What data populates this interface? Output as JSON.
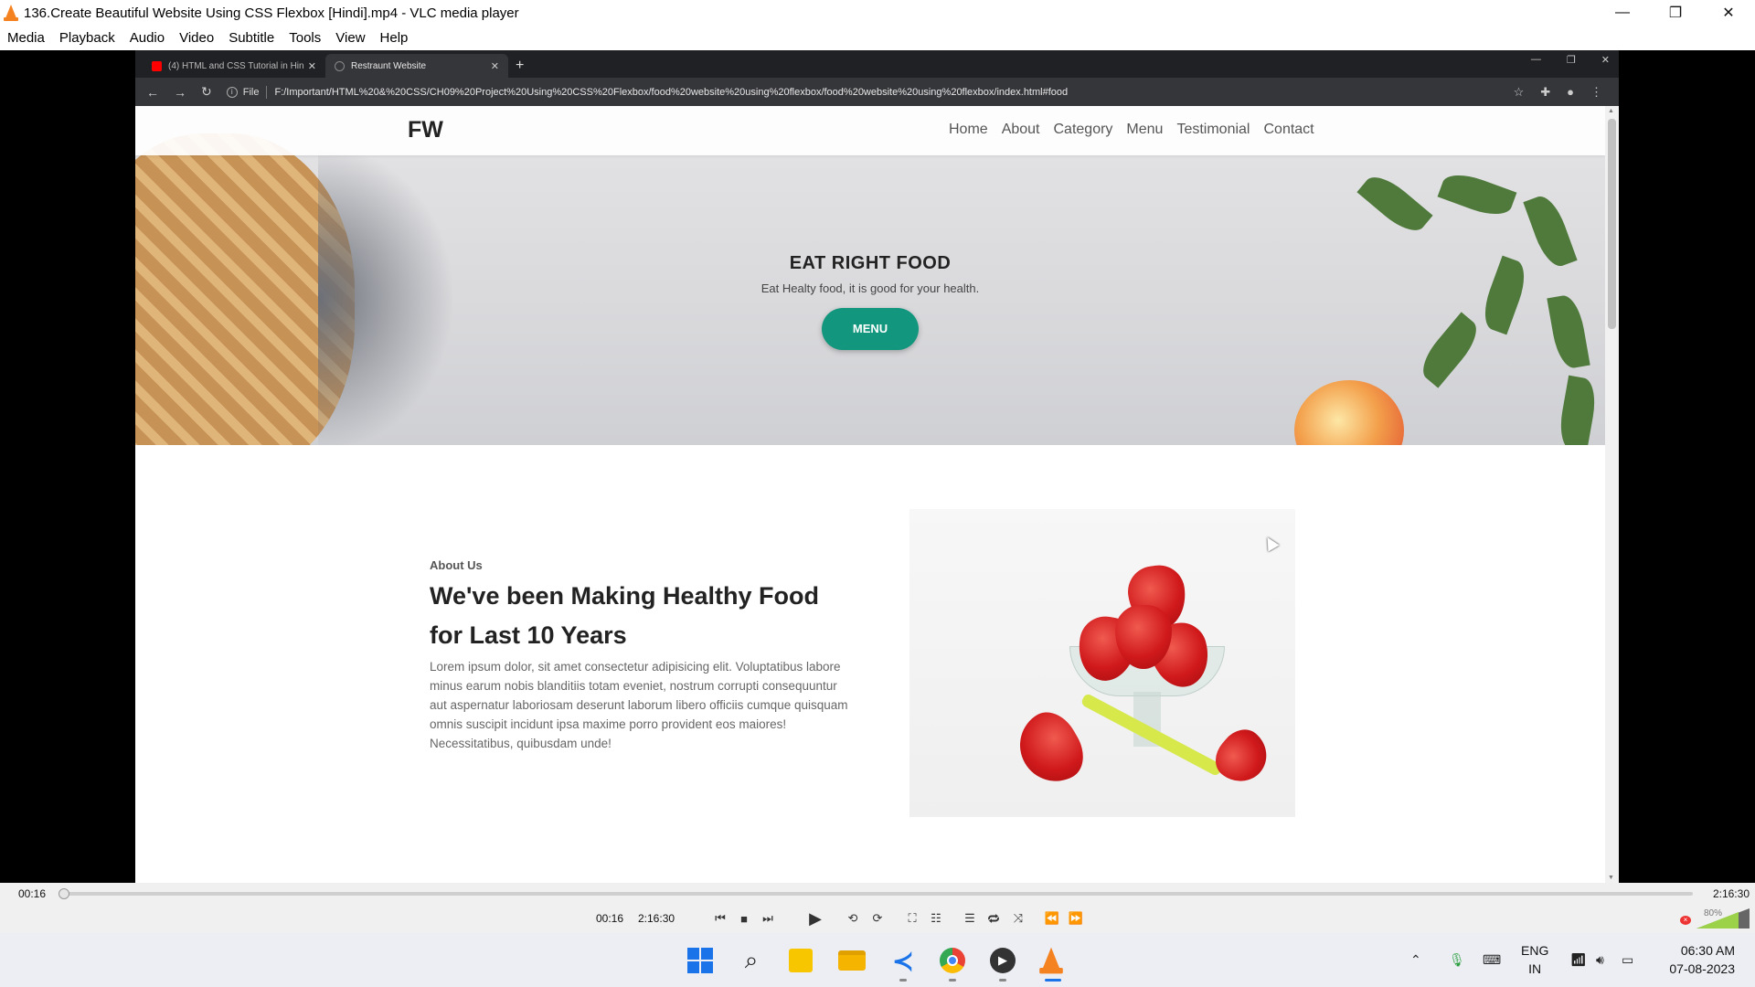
{
  "window": {
    "title": "136.Create Beautiful Website Using CSS Flexbox [Hindi].mp4 - VLC media player",
    "controls": [
      "—",
      "❐",
      "✕"
    ]
  },
  "menu": [
    "Media",
    "Playback",
    "Audio",
    "Video",
    "Subtitle",
    "Tools",
    "View",
    "Help"
  ],
  "browser": {
    "tabs": [
      {
        "label": "(4) HTML and CSS Tutorial in Hin",
        "icon": "youtube-icon"
      },
      {
        "label": "Restraunt Website",
        "icon": "globe-icon"
      }
    ],
    "new_tab": "+",
    "file_label": "File",
    "url": "F:/Important/HTML%20&%20CSS/CH09%20Project%20Using%20CSS%20Flexbox/food%20website%20using%20flexbox/food%20website%20using%20flexbox/index.html#food"
  },
  "site": {
    "logo": "FW",
    "nav": [
      "Home",
      "About",
      "Category",
      "Menu",
      "Testimonial",
      "Contact"
    ],
    "hero": {
      "heading": "EAT RIGHT FOOD",
      "subtext": "Eat Healty food, it is good for your health.",
      "button": "MENU"
    },
    "about": {
      "label": "About Us",
      "title": "We've been Making Healthy Food for Last 10 Years",
      "text": "Lorem ipsum dolor, sit amet consectetur adipisicing elit. Voluptatibus labore minus earum nobis blanditiis totam eveniet, nostrum corrupti consequuntur aut aspernatur laboriosam deserunt laborum libero officiis cumque quisquam omnis suscipit incidunt ipsa maxime porro provident eos maiores! Necessitatibus, quibusdam unde!"
    }
  },
  "player": {
    "elapsed": "00:16",
    "total": "2:16:30",
    "progress": 0.002,
    "volume": "80%",
    "volume_level": 0.8
  },
  "taskbar": {
    "language": "ENG",
    "region": "IN",
    "time": "06:30 AM",
    "date": "07-08-2023"
  },
  "colors": {
    "accent": "#12967e",
    "vlc_orange": "#f58220",
    "windows_blue": "#1a73e8"
  }
}
